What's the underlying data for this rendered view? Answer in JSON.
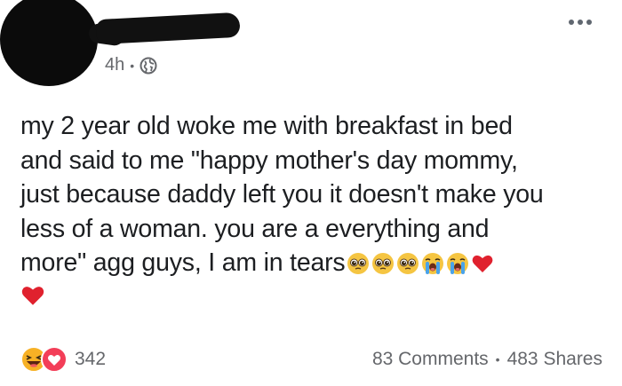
{
  "post": {
    "timestamp": "4h",
    "meta_separator": "•",
    "privacy_icon": "globe-icon",
    "more_icon": "more-options-icon",
    "text_lines": [
      "my 2 year old woke me with breakfast in bed",
      "and said to me \"happy mother's day mommy,",
      "just because daddy left you it doesn't make you",
      "less of a woman. you are a everything and",
      "more\" agg guys, I am in tears"
    ],
    "emojis_inline": [
      "pleading-face-icon",
      "pleading-face-icon",
      "pleading-face-icon",
      "loudly-crying-face-icon",
      "loudly-crying-face-icon",
      "red-heart-icon"
    ],
    "emojis_next_line": [
      "red-heart-icon"
    ]
  },
  "footer": {
    "reaction_icons": [
      "haha-reaction-icon",
      "love-reaction-icon"
    ],
    "reaction_count": "342",
    "comments": "83 Comments",
    "stats_separator": "•",
    "shares": "483 Shares"
  },
  "colors": {
    "text": "#1c1e21",
    "meta": "#65676b",
    "love": "#f33e58",
    "haha": "#f7b125",
    "heart": "#e0212e"
  }
}
